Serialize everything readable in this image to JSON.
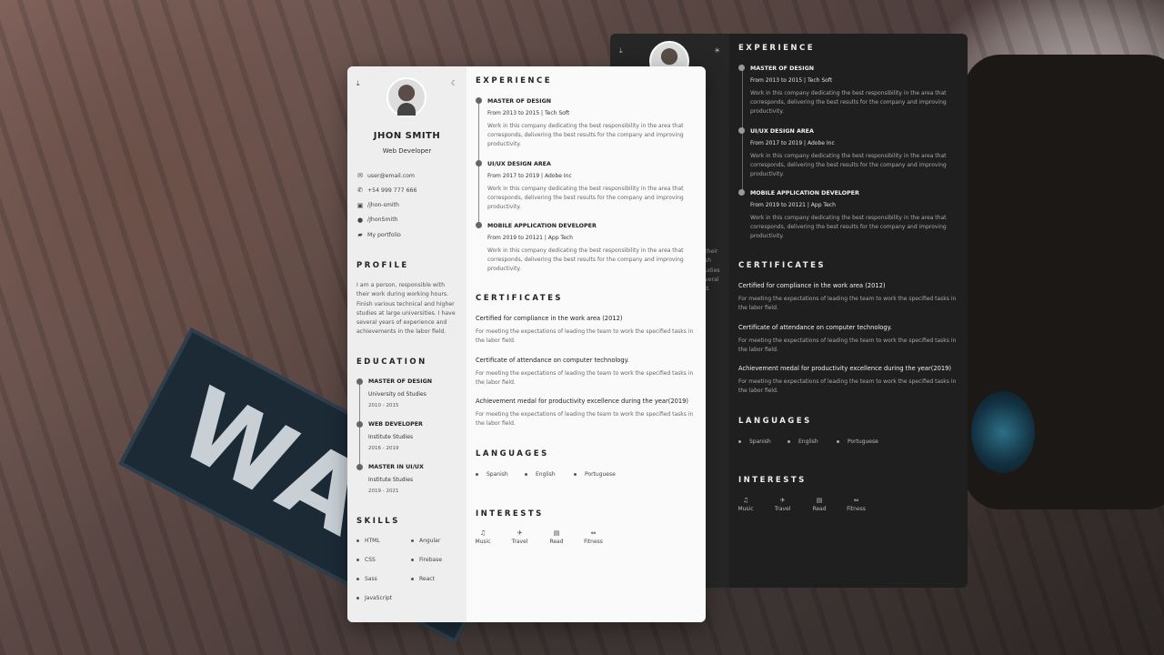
{
  "profile": {
    "name": "JHON SMITH",
    "role": "Web Developer",
    "contacts": [
      {
        "icon": "mail-icon",
        "glyph": "✉",
        "text": "user@email.com"
      },
      {
        "icon": "phone-icon",
        "glyph": "✆",
        "text": "+54 999 777 666"
      },
      {
        "icon": "linkedin-icon",
        "glyph": "▣",
        "text": "/jhon-smith"
      },
      {
        "icon": "github-icon",
        "glyph": "●",
        "text": "/JhonSmith"
      },
      {
        "icon": "folder-icon",
        "glyph": "▰",
        "text": "My portfolio"
      }
    ],
    "profile_heading": "PROFILE",
    "profile_text": "I am a person, responsible with their work during working hours. Finish various technical and higher studies at large universities. I have several years of experience and achievements in the labor field.",
    "education_heading": "EDUCATION",
    "education": [
      {
        "title": "MASTER OF DESIGN",
        "school": "University od Studies",
        "years": "2010 - 2015"
      },
      {
        "title": "WEB DEVELOPER",
        "school": "Institute Studies",
        "years": "2016 - 2019"
      },
      {
        "title": "MASTER IN UI/UX",
        "school": "Institute Studies",
        "years": "2019 - 2021"
      }
    ],
    "skills_heading": "SKILLS",
    "skills_col1": [
      "HTML",
      "CSS",
      "Sass",
      "JavaScript"
    ],
    "skills_col2": [
      "Angular",
      "Firebase",
      "React"
    ]
  },
  "experience_heading": "EXPERIENCE",
  "experience": [
    {
      "title": "MASTER OF DESIGN",
      "meta": "From 2013 to 2015 | Tech Soft",
      "desc": "Work in this company dedicating the best responsibility in the area that corresponds, delivering the best results for the company and improving productivity."
    },
    {
      "title": "UI/UX DESIGN AREA",
      "meta": "From 2017 to 2019 | Adobe Inc",
      "desc": "Work in this company dedicating the best responsibility in the area that corresponds, delivering the best results for the company and improving productivity."
    },
    {
      "title": "MOBILE APPLICATION DEVELOPER",
      "meta": "From 2019 to 20121 | App Tech",
      "desc": "Work in this company dedicating the best responsibility in the area that corresponds, delivering the best results for the company and improving productivity."
    }
  ],
  "certificates_heading": "CERTIFICATES",
  "certificates": [
    {
      "title": "Certified for compliance in the work area (2012)",
      "desc": "For meeting the expectations of leading the team to work the specified tasks in the labor field."
    },
    {
      "title": "Certificate of attendance on computer technology.",
      "desc": "For meeting the expectations of leading the team to work the specified tasks in the labor field."
    },
    {
      "title": "Achievement medal for productivity excellence during the year(2019)",
      "desc": "For meeting the expectations of leading the team to work the specified tasks in the labor field."
    }
  ],
  "languages_heading": "LANGUAGES",
  "languages": [
    "Spanish",
    "English",
    "Portuguese"
  ],
  "interests_heading": "INTERESTS",
  "interests": [
    {
      "icon": "headphones-icon",
      "glyph": "♫",
      "label": "Music"
    },
    {
      "icon": "plane-icon",
      "glyph": "✈",
      "label": "Travel"
    },
    {
      "icon": "book-icon",
      "glyph": "▤",
      "label": "Read"
    },
    {
      "icon": "dumbbell-icon",
      "glyph": "⇔",
      "label": "Fitness"
    }
  ],
  "dark_peek_text": [
    "their",
    "sh",
    "udies",
    "veral",
    "d."
  ],
  "background_sign": "WA",
  "colors": {
    "light_card": "#fafafa",
    "light_sidebar": "#eeeeee",
    "dark_card": "#1f1f1f",
    "dark_sidebar": "#262626"
  }
}
